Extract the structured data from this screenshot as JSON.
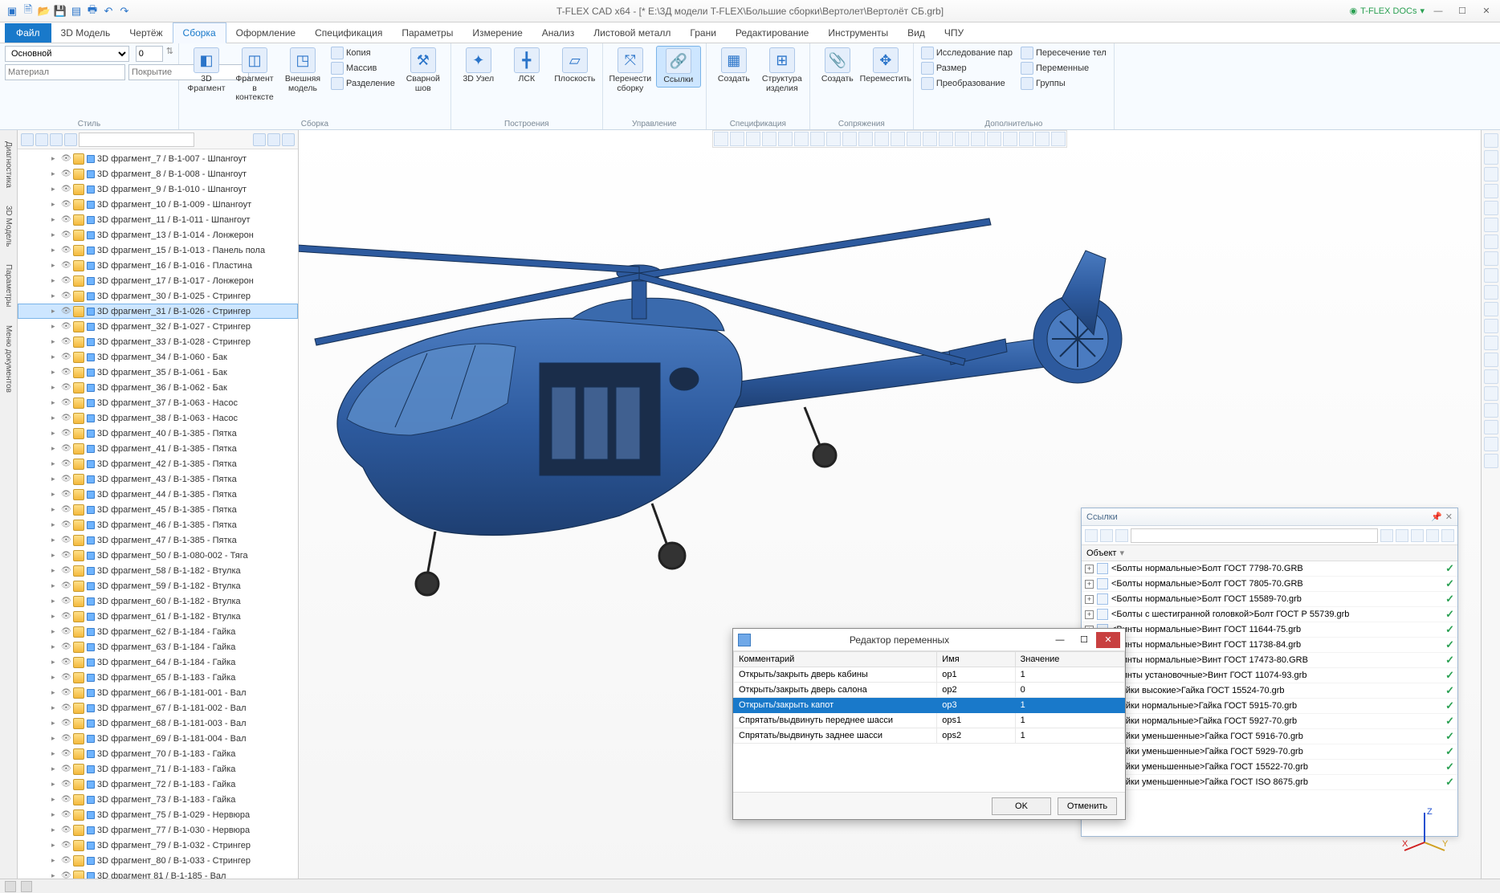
{
  "titlebar": {
    "title": "T-FLEX CAD x64 - [* E:\\3Д модели T-FLEX\\Большие сборки\\Вертолет\\Вертолёт СБ.grb]",
    "docs_label": "T-FLEX DOCs"
  },
  "tabs": {
    "file": "Файл",
    "items": [
      "3D Модель",
      "Чертёж",
      "Сборка",
      "Оформление",
      "Спецификация",
      "Параметры",
      "Измерение",
      "Анализ",
      "Листовой металл",
      "Грани",
      "Редактирование",
      "Инструменты",
      "Вид",
      "ЧПУ"
    ],
    "active": "Сборка"
  },
  "ribbon": {
    "style": {
      "preset": "Основной",
      "spin": "0",
      "material": "Материал",
      "coating": "Покрытие",
      "label": "Стиль"
    },
    "g_assembly": {
      "frag3d": "3D Фрагмент",
      "frag_ctx": "Фрагмент в контексте",
      "ext_model": "Внешняя модель",
      "copy": "Копия",
      "array": "Массив",
      "split": "Разделение",
      "weld": "Сварной шов",
      "label": "Сборка"
    },
    "g_build": {
      "node3d": "3D Узел",
      "lcs": "ЛСК",
      "plane": "Плоскость",
      "label": "Построения"
    },
    "g_manage": {
      "move_asm": "Перенести сборку",
      "links": "Ссылки",
      "label": "Управление"
    },
    "g_spec": {
      "create": "Создать",
      "struct": "Структура изделия",
      "label": "Спецификация"
    },
    "g_mate": {
      "create": "Создать",
      "move": "Переместить",
      "label": "Сопряжения"
    },
    "g_extra": {
      "pair": "Исследование пар",
      "size": "Размер",
      "transform": "Преобразование",
      "intersect": "Пересечение тел",
      "vars": "Переменные",
      "groups": "Группы",
      "label": "Дополнительно"
    }
  },
  "side_tabs": [
    "Диагностика",
    "3D Модель",
    "Параметры",
    "Меню документов"
  ],
  "tree_items": [
    {
      "t": "3D фрагмент_7 / B-1-007 - Шпангоут"
    },
    {
      "t": "3D фрагмент_8 / B-1-008 - Шпангоут"
    },
    {
      "t": "3D фрагмент_9 / B-1-010 - Шпангоут"
    },
    {
      "t": "3D фрагмент_10 / B-1-009 - Шпангоут"
    },
    {
      "t": "3D фрагмент_11 / B-1-011 - Шпангоут"
    },
    {
      "t": "3D фрагмент_13 / B-1-014 - Лонжерон"
    },
    {
      "t": "3D фрагмент_15 / B-1-013 - Панель пола"
    },
    {
      "t": "3D фрагмент_16 / B-1-016 - Пластина"
    },
    {
      "t": "3D фрагмент_17 / B-1-017 - Лонжерон"
    },
    {
      "t": "3D фрагмент_30 / B-1-025 - Стрингер"
    },
    {
      "t": "3D фрагмент_31 / B-1-026 - Стрингер",
      "sel": true
    },
    {
      "t": "3D фрагмент_32 / B-1-027 - Стрингер"
    },
    {
      "t": "3D фрагмент_33 / B-1-028 - Стрингер"
    },
    {
      "t": "3D фрагмент_34 / B-1-060 - Бак"
    },
    {
      "t": "3D фрагмент_35 / B-1-061 - Бак"
    },
    {
      "t": "3D фрагмент_36 / B-1-062 - Бак"
    },
    {
      "t": "3D фрагмент_37 / B-1-063 - Насос"
    },
    {
      "t": "3D фрагмент_38 / B-1-063 - Насос"
    },
    {
      "t": "3D фрагмент_40 / B-1-385 - Пятка"
    },
    {
      "t": "3D фрагмент_41 / B-1-385 - Пятка"
    },
    {
      "t": "3D фрагмент_42 / B-1-385 - Пятка"
    },
    {
      "t": "3D фрагмент_43 / B-1-385 - Пятка"
    },
    {
      "t": "3D фрагмент_44 / B-1-385 - Пятка"
    },
    {
      "t": "3D фрагмент_45 / B-1-385 - Пятка"
    },
    {
      "t": "3D фрагмент_46 / B-1-385 - Пятка"
    },
    {
      "t": "3D фрагмент_47 / B-1-385 - Пятка"
    },
    {
      "t": "3D фрагмент_50 / B-1-080-002 - Тяга"
    },
    {
      "t": "3D фрагмент_58 / B-1-182 - Втулка"
    },
    {
      "t": "3D фрагмент_59 / B-1-182 - Втулка"
    },
    {
      "t": "3D фрагмент_60 / B-1-182 - Втулка"
    },
    {
      "t": "3D фрагмент_61 / B-1-182 - Втулка"
    },
    {
      "t": "3D фрагмент_62 / B-1-184 - Гайка"
    },
    {
      "t": "3D фрагмент_63 / B-1-184 - Гайка"
    },
    {
      "t": "3D фрагмент_64 / B-1-184 - Гайка"
    },
    {
      "t": "3D фрагмент_65 / B-1-183 - Гайка"
    },
    {
      "t": "3D фрагмент_66 / B-1-181-001 - Вал"
    },
    {
      "t": "3D фрагмент_67 / B-1-181-002 - Вал"
    },
    {
      "t": "3D фрагмент_68 / B-1-181-003 - Вал"
    },
    {
      "t": "3D фрагмент_69 / B-1-181-004 - Вал"
    },
    {
      "t": "3D фрагмент_70 / B-1-183 - Гайка"
    },
    {
      "t": "3D фрагмент_71 / B-1-183 - Гайка"
    },
    {
      "t": "3D фрагмент_72 / B-1-183 - Гайка"
    },
    {
      "t": "3D фрагмент_73 / B-1-183 - Гайка"
    },
    {
      "t": "3D фрагмент_75 / B-1-029 - Нервюра"
    },
    {
      "t": "3D фрагмент_77 / B-1-030 - Нервюра"
    },
    {
      "t": "3D фрагмент_79 / B-1-032 - Стрингер"
    },
    {
      "t": "3D фрагмент_80 / B-1-033 - Стрингер"
    },
    {
      "t": "3D фрагмент 81 / B-1-185 - Вал"
    }
  ],
  "links_panel": {
    "title": "Ссылки",
    "col_object": "Объект",
    "items": [
      "<Болты нормальные>Болт ГОСТ 7798-70.GRB",
      "<Болты нормальные>Болт ГОСТ 7805-70.GRB",
      "<Болты нормальные>Болт ГОСТ 15589-70.grb",
      "<Болты с шестигранной головкой>Болт ГОСТ Р 55739.grb",
      "<Винты нормальные>Винт ГОСТ 11644-75.grb",
      "<Винты нормальные>Винт ГОСТ 11738-84.grb",
      "<Винты нормальные>Винт ГОСТ 17473-80.GRB",
      "<Винты установочные>Винт ГОСТ 11074-93.grb",
      "<Гайки высокие>Гайка ГОСТ 15524-70.grb",
      "<Гайки нормальные>Гайка ГОСТ 5915-70.grb",
      "<Гайки нормальные>Гайка ГОСТ 5927-70.grb",
      "<Гайки уменьшенные>Гайка ГОСТ 5916-70.grb",
      "<Гайки уменьшенные>Гайка ГОСТ 5929-70.grb",
      "<Гайки уменьшенные>Гайка ГОСТ 15522-70.grb",
      "<Гайки уменьшенные>Гайка ГОСТ ISO 8675.grb"
    ]
  },
  "var_dialog": {
    "title": "Редактор переменных",
    "col_comment": "Комментарий",
    "col_name": "Имя",
    "col_value": "Значение",
    "rows": [
      {
        "c": "Открыть/закрыть дверь кабины",
        "n": "op1",
        "v": "1"
      },
      {
        "c": "Открыть/закрыть дверь салона",
        "n": "op2",
        "v": "0"
      },
      {
        "c": "Открыть/закрыть капот",
        "n": "op3",
        "v": "1",
        "sel": true
      },
      {
        "c": "Спрятать/выдвинуть переднее шасси",
        "n": "ops1",
        "v": "1"
      },
      {
        "c": "Спрятать/выдвинуть заднее шасси",
        "n": "ops2",
        "v": "1"
      }
    ],
    "ok": "OK",
    "cancel": "Отменить"
  }
}
